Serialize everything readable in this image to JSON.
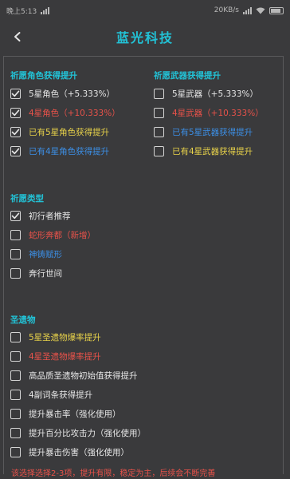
{
  "status": {
    "left_text": "晚上5:13",
    "right_text": "20KB/s"
  },
  "header": {
    "title": "蓝光科技"
  },
  "sections": {
    "char_wish": {
      "title": "祈愿角色获得提升",
      "items": [
        {
          "label": "5星角色（+5.333%）",
          "checked": true,
          "color": "#e6e6e6"
        },
        {
          "label": "4星角色（+10.333%）",
          "checked": true,
          "color": "#e8524a"
        },
        {
          "label": "已有5星角色获得提升",
          "checked": true,
          "color": "#e8d24a"
        },
        {
          "label": "已有4星角色获得提升",
          "checked": true,
          "color": "#3c8fe6"
        }
      ]
    },
    "weapon_wish": {
      "title": "祈愿武器获得提升",
      "items": [
        {
          "label": "5星武器（+5.333%）",
          "checked": false,
          "color": "#e6e6e6"
        },
        {
          "label": "4星武器（+10.333%）",
          "checked": false,
          "color": "#e8524a"
        },
        {
          "label": "已有5星武器获得提升",
          "checked": false,
          "color": "#3c8fe6"
        },
        {
          "label": "已有4星武器获得提升",
          "checked": false,
          "color": "#e8d24a"
        }
      ]
    },
    "wish_type": {
      "title": "祈愿类型",
      "items": [
        {
          "label": "初行者推荐",
          "checked": true,
          "color": "#e6e6e6"
        },
        {
          "label": "蛇形奔都（新增）",
          "checked": false,
          "color": "#e8524a"
        },
        {
          "label": "神铸赋形",
          "checked": false,
          "color": "#3c8fe6"
        },
        {
          "label": "奔行世间",
          "checked": false,
          "color": "#e6e6e6"
        }
      ]
    },
    "artifacts": {
      "title": "圣遗物",
      "items": [
        {
          "label": "5星圣遗物爆率提升",
          "checked": false,
          "color": "#e8d24a"
        },
        {
          "label": "4星圣遗物爆率提升",
          "checked": false,
          "color": "#e8524a"
        },
        {
          "label": "高品质圣遗物初始值获得提升",
          "checked": false,
          "color": "#e6e6e6"
        },
        {
          "label": "4副词条获得提升",
          "checked": false,
          "color": "#e6e6e6"
        },
        {
          "label": "提升暴击率（强化使用）",
          "checked": false,
          "color": "#e6e6e6"
        },
        {
          "label": "提升百分比攻击力（强化使用）",
          "checked": false,
          "color": "#e6e6e6"
        },
        {
          "label": "提升暴击伤害（强化使用）",
          "checked": false,
          "color": "#e6e6e6"
        }
      ]
    }
  },
  "footer_note": "该选择选择2-3项，提升有限，稳定为主，后续会不断完善"
}
